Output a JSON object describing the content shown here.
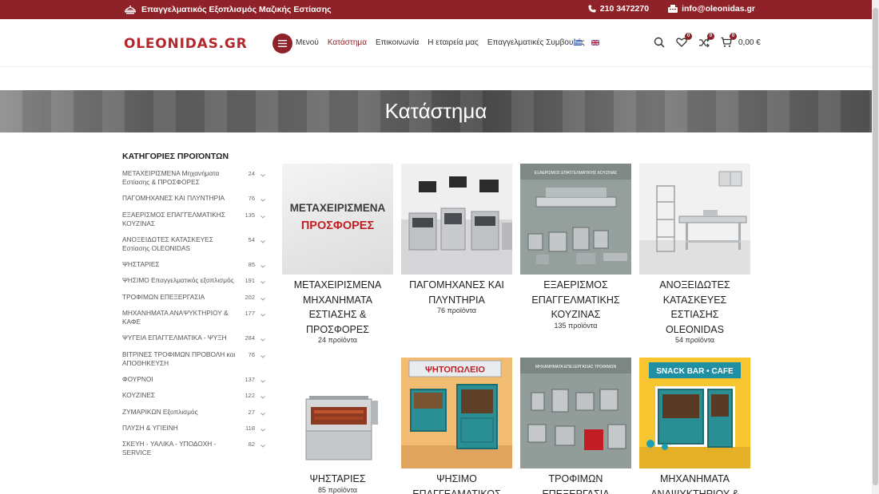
{
  "topbar": {
    "tagline": "Επαγγελματικός Εξοπλισμός Μαζικής Εστίασης",
    "phone": "210 3472270",
    "email": "info@oleonidas.gr"
  },
  "header": {
    "logo": "OLEONIDAS.GR",
    "menu_label": "Μενού",
    "nav": [
      "Κατάστημα",
      "Επικοινωνία",
      "Η εταιρεία μας",
      "Επαγγελματικές Συμβουλές"
    ],
    "wishlist_count": "0",
    "compare_count": "0",
    "cart_count": "0",
    "cart_total": "0,00 €"
  },
  "hero": {
    "title": "Κατάστημα"
  },
  "sidebar": {
    "title": "ΚΑΤΗΓΟΡΙΕΣ ΠΡΟΙΌΝΤΩΝ",
    "items": [
      {
        "label": "ΜΕΤΑΧΕΙΡΙΣΜΕΝΑ Μηχανήματα Εστίασης & ΠΡΟΣΦΟΡΕΣ",
        "count": "24"
      },
      {
        "label": "ΠΑΓΟΜΗΧΑΝΕΣ ΚΑΙ ΠΛΥΝΤΗΡΙΑ",
        "count": "76"
      },
      {
        "label": "ΕΞΑΕΡΙΣΜΟΣ ΕΠΑΓΓΕΛΜΑΤΙΚΗΣ ΚΟΥΖΙΝΑΣ",
        "count": "135"
      },
      {
        "label": "ΑΝΟΞΕΙΔΩΤΕΣ ΚΑΤΑΣΚΕΥΕΣ Εστίασης OLEONIDAS",
        "count": "54"
      },
      {
        "label": "ΨΗΣΤΑΡΙΕΣ",
        "count": "85"
      },
      {
        "label": "ΨΗΣΙΜΟ Επαγγελματικός εξοπλισμός",
        "count": "191"
      },
      {
        "label": "ΤΡΟΦΙΜΩΝ ΕΠΕΞΕΡΓΑΣΙΑ",
        "count": "202"
      },
      {
        "label": "ΜΗΧΑΝΗΜΑΤΑ ΑΝΑΨΥΚΤΗΡΙΟΥ & ΚΑΦΕ",
        "count": "177"
      },
      {
        "label": "ΨΥΓΕΙΑ ΕΠΑΓΓΕΛΜΑΤΙΚΑ - ΨΥΞΗ",
        "count": "284"
      },
      {
        "label": "ΒΙΤΡΙΝΕΣ ΤΡΟΦΙΜΩΝ ΠΡΟΒΟΛΗ και ΑΠΟΘΗΚΕΥΣΗ",
        "count": "76"
      },
      {
        "label": "ΦΟΥΡΝΟΙ",
        "count": "137"
      },
      {
        "label": "ΚΟΥΖΙΝΕΣ",
        "count": "122"
      },
      {
        "label": "ΖΥΜΑΡΙΚΩΝ Εξοπλισμός",
        "count": "27"
      },
      {
        "label": "ΠΛΥΣΗ & ΥΓΙΕΙΝΗ",
        "count": "118"
      },
      {
        "label": "ΣΚΕΥΗ - ΥΑΛΙΚΑ - ΥΠΟΔΟΧΗ - SERVICE",
        "count": "82"
      }
    ]
  },
  "products": [
    {
      "name": "ΜΕΤΑΧΕΙΡΙΣΜΕΝΑ ΜΗΧΑΝΗΜΑΤΑ ΕΣΤΙΑΣΗΣ & ΠΡΟΣΦΟΡΕΣ",
      "count": "24 προϊόντα",
      "img_text1": "ΜΕΤΑΧΕΙΡΙΣΜΕΝΑ",
      "img_text2": "ΠΡΟΣΦΟΡΕΣ"
    },
    {
      "name": "ΠΑΓΟΜΗΧΑΝΕΣ ΚΑΙ ΠΛΥΝΤΗΡΙΑ",
      "count": "76 προϊόντα"
    },
    {
      "name": "ΕΞΑΕΡΙΣΜΟΣ ΕΠΑΓΓΕΛΜΑΤΙΚΗΣ ΚΟΥΖΙΝΑΣ",
      "count": "135 προϊόντα",
      "img_text1": "ΕΞΑΕΡΙΣΜΟΣ ΕΠΑΓΓΕΛΜΑΤΙΚΗΣ ΚΟΥΖΙΝΑΣ"
    },
    {
      "name": "ΑΝΟΞΕΙΔΩΤΕΣ ΚΑΤΑΣΚΕΥΕΣ ΕΣΤΙΑΣΗΣ OLEONIDAS",
      "count": "54 προϊόντα"
    },
    {
      "name": "ΨΗΣΤΑΡΙΕΣ",
      "count": "85 προϊόντα"
    },
    {
      "name": "ΨΗΣΙΜΟ ΕΠΑΓΓΕΛΜΑΤΙΚΟΣ",
      "count": "",
      "img_text1": "ΨΗΤΟΠΩΛΕΙΟ"
    },
    {
      "name": "ΤΡΟΦΙΜΩΝ ΕΠΕΞΕΡΓΑΣΙΑ",
      "count": "",
      "img_text1": "ΜΗΧΑΝΗΜΑΤΑ ΕΠΕΞΕΡΓΑΣΙΑΣ ΤΡΟΦΙΜΩΝ"
    },
    {
      "name": "ΜΗΧΑΝΗΜΑΤΑ ΑΝΑΨΥΚΤΗΡΙΟΥ &",
      "count": "",
      "img_text1": "SNACK BAR • CAFE"
    }
  ],
  "colors": {
    "brand": "#8e2228",
    "logo": "#b3272d",
    "cafe_yellow": "#f5c22e",
    "door_teal": "#2a8f95"
  }
}
